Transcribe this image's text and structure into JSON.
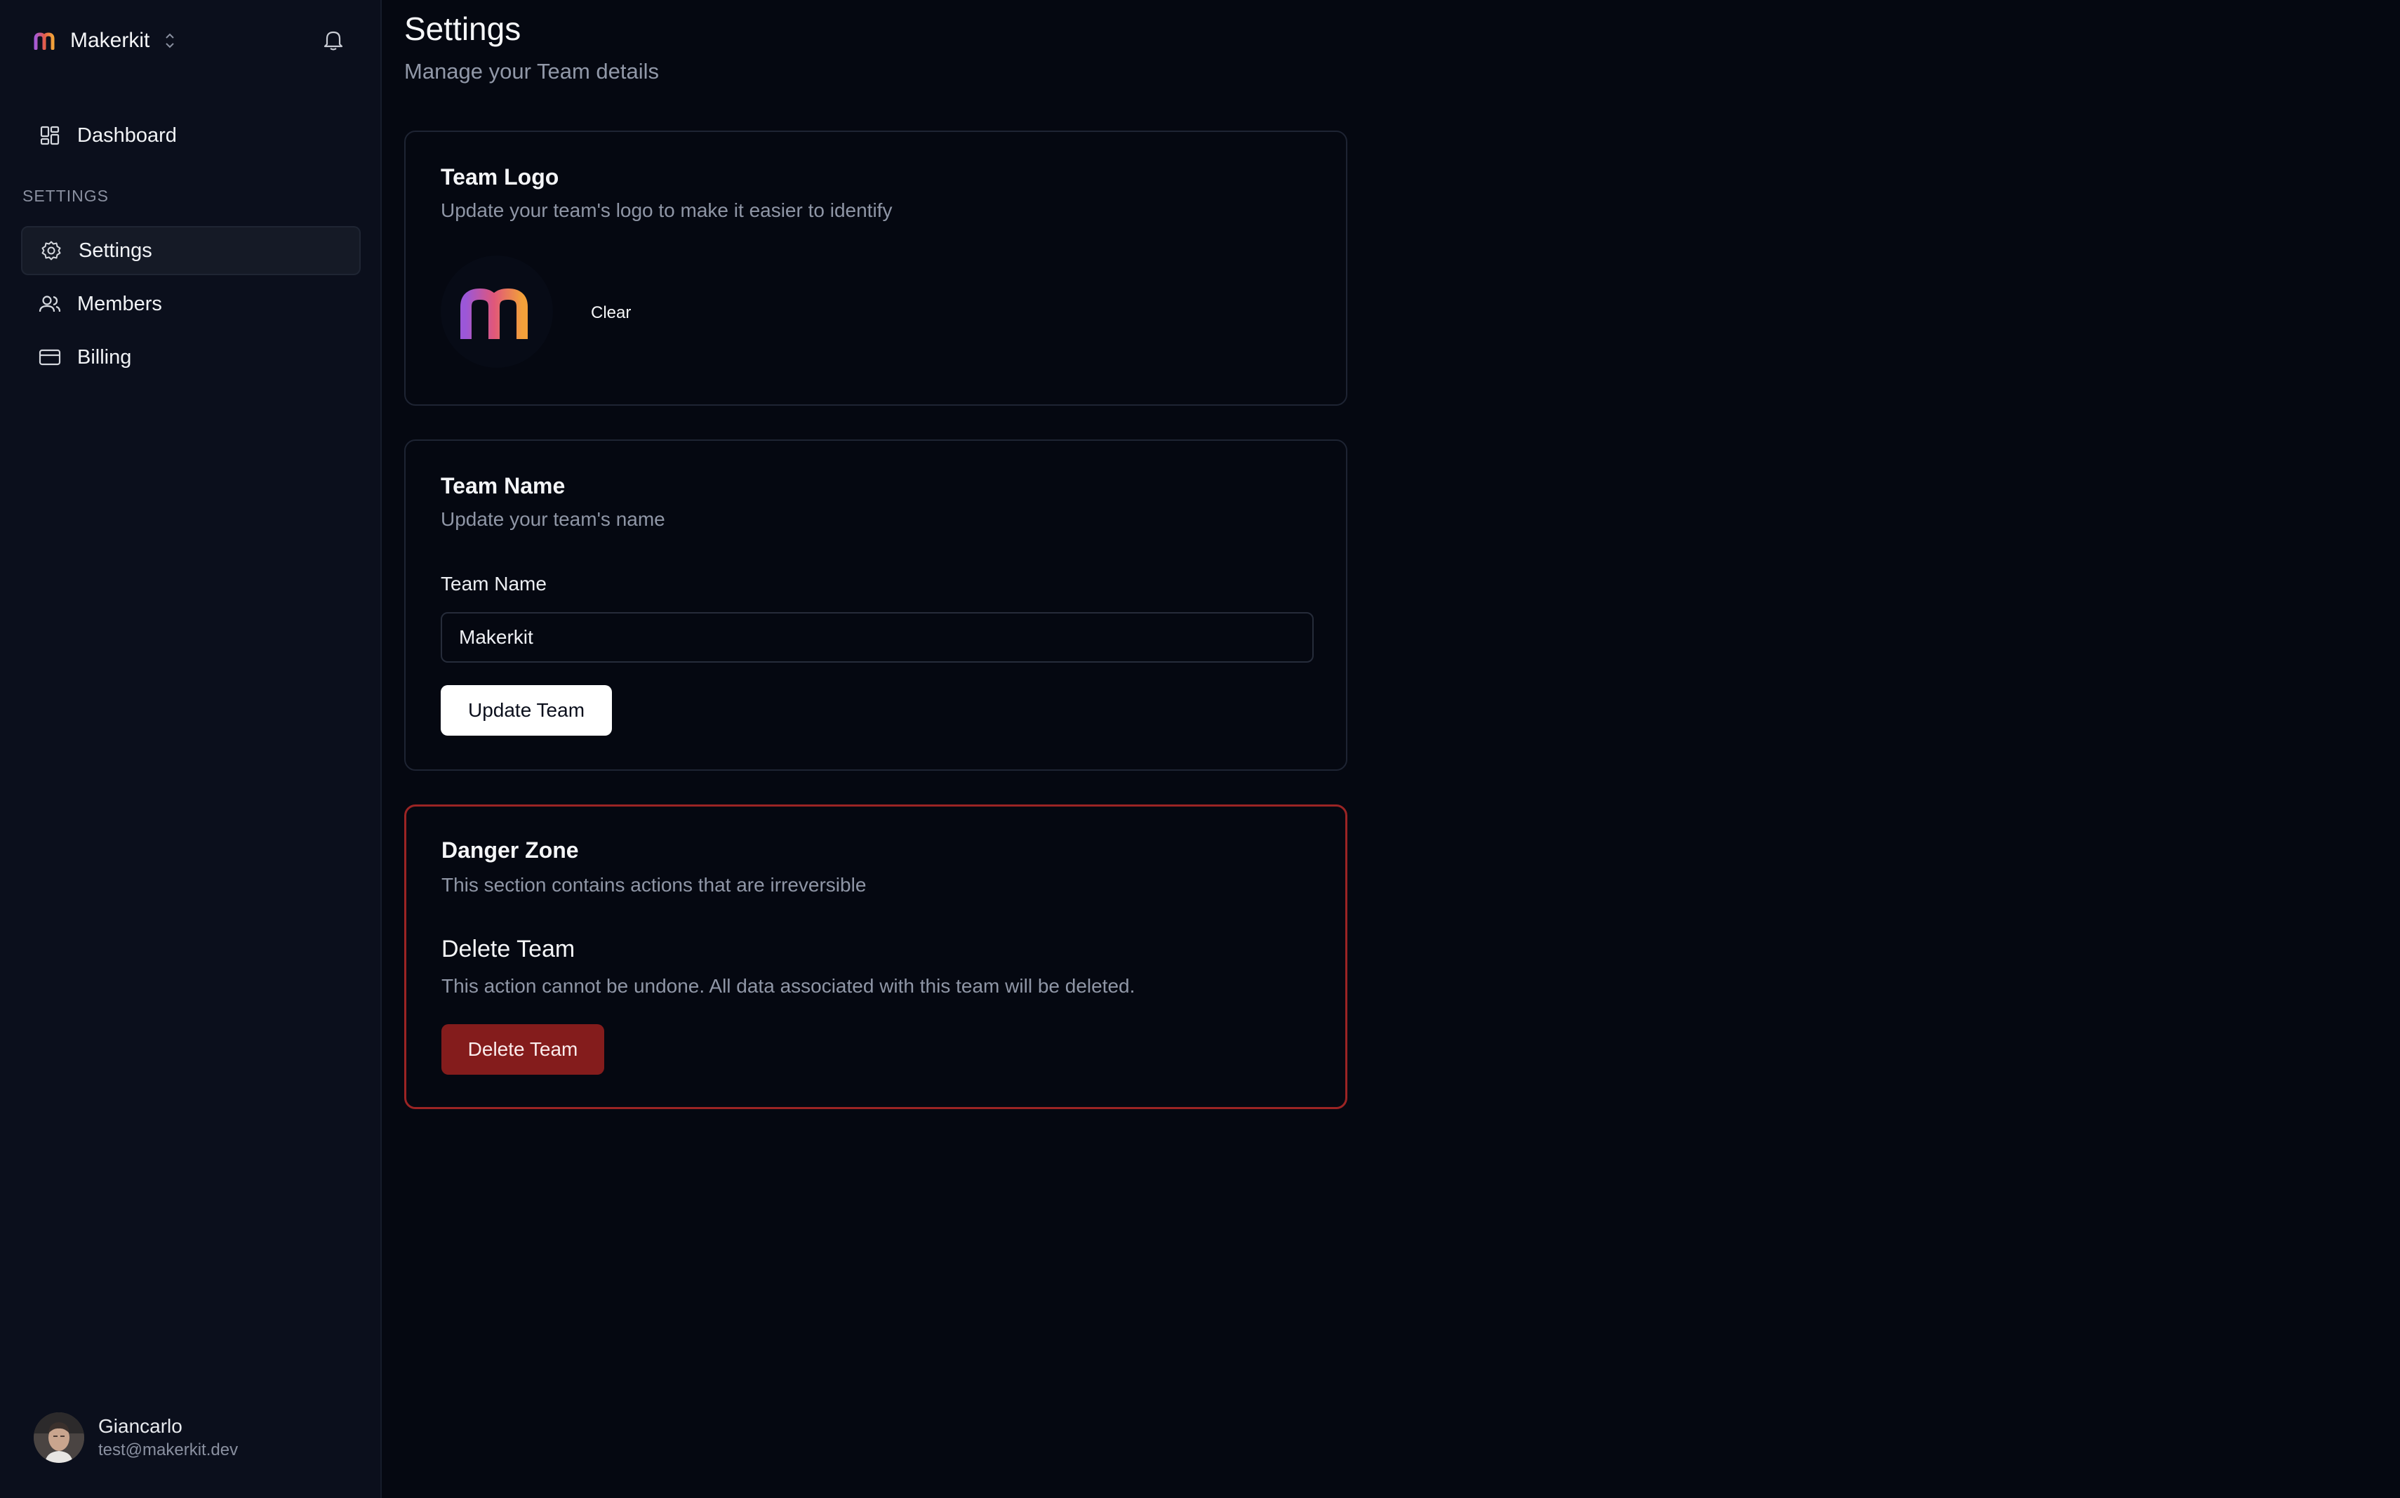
{
  "sidebar": {
    "team_name": "Makerkit",
    "section_label": "SETTINGS",
    "items": [
      {
        "label": "Dashboard",
        "icon": "dashboard-icon"
      },
      {
        "label": "Settings",
        "icon": "gear-icon",
        "active": true
      },
      {
        "label": "Members",
        "icon": "users-icon"
      },
      {
        "label": "Billing",
        "icon": "credit-card-icon"
      }
    ],
    "user": {
      "name": "Giancarlo",
      "email": "test@makerkit.dev"
    }
  },
  "page": {
    "title": "Settings",
    "subtitle": "Manage your Team details"
  },
  "team_logo": {
    "title": "Team Logo",
    "description": "Update your team's logo to make it easier to identify",
    "clear_label": "Clear"
  },
  "team_name": {
    "title": "Team Name",
    "description": "Update your team's name",
    "field_label": "Team Name",
    "value": "Makerkit",
    "button_label": "Update Team"
  },
  "danger_zone": {
    "title": "Danger Zone",
    "description": "This section contains actions that are irreversible",
    "delete_title": "Delete Team",
    "delete_description": "This action cannot be undone. All data associated with this team will be deleted.",
    "delete_button": "Delete Team"
  },
  "colors": {
    "background": "#050811",
    "sidebar": "#0b0f1c",
    "danger": "#9b2424",
    "danger_button": "#841c1c"
  }
}
